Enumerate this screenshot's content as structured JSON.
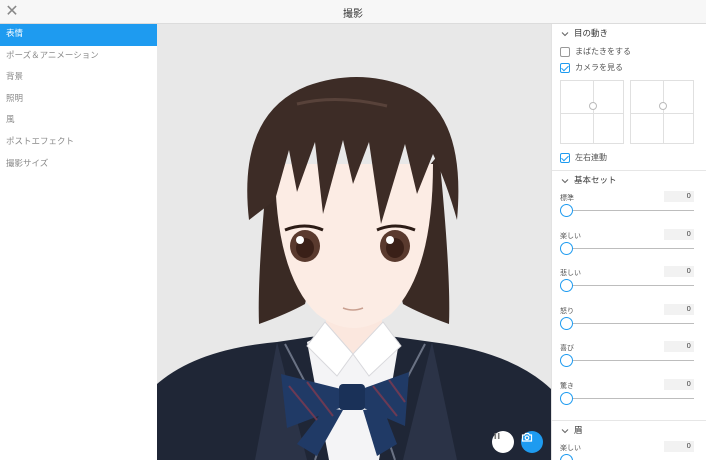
{
  "window": {
    "title": "撮影",
    "close_icon": "close-icon"
  },
  "sidebar": {
    "items": [
      {
        "label": "表情",
        "active": true
      },
      {
        "label": "ポーズ＆アニメーション",
        "active": false
      },
      {
        "label": "背景",
        "active": false
      },
      {
        "label": "照明",
        "active": false
      },
      {
        "label": "風",
        "active": false
      },
      {
        "label": "ポストエフェクト",
        "active": false
      },
      {
        "label": "撮影サイズ",
        "active": false
      }
    ]
  },
  "viewport": {
    "pause_icon": "pause-icon",
    "camera_icon": "camera-icon"
  },
  "panel": {
    "eye_section": {
      "title": "目の動き",
      "blink_label": "まばたきをする",
      "blink_checked": false,
      "look_camera_label": "カメラを見る",
      "look_camera_checked": true,
      "sync_label": "左右連動",
      "sync_checked": true
    },
    "basic_section": {
      "title": "基本セット",
      "sliders": [
        {
          "label": "標準",
          "value": "0"
        },
        {
          "label": "楽しい",
          "value": "0"
        },
        {
          "label": "悲しい",
          "value": "0"
        },
        {
          "label": "怒り",
          "value": "0"
        },
        {
          "label": "喜び",
          "value": "0"
        },
        {
          "label": "驚き",
          "value": "0"
        }
      ]
    },
    "brow_section": {
      "title": "眉",
      "sliders": [
        {
          "label": "楽しい",
          "value": "0"
        }
      ]
    }
  },
  "colors": {
    "accent": "#1e9bf0",
    "viewport_bg": "#e8e8e8"
  }
}
